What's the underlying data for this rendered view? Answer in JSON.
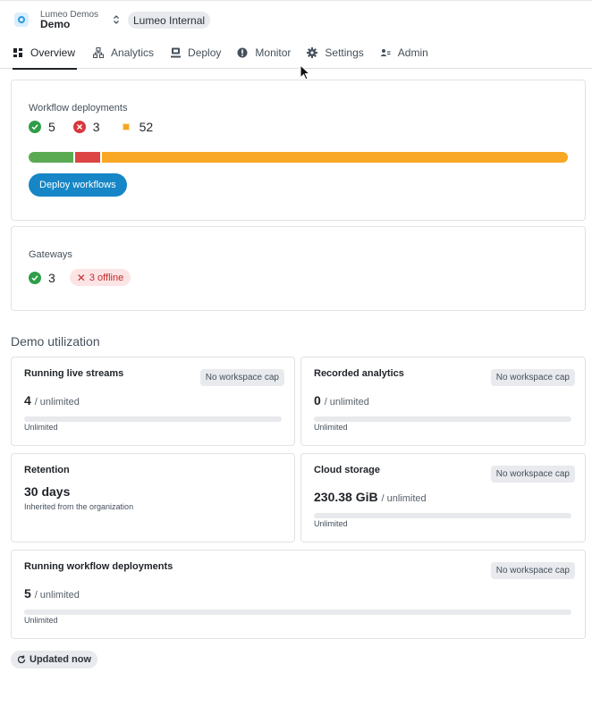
{
  "header": {
    "org_name": "Lumeo Demos",
    "workspace_name": "Demo",
    "workspace_badge": "Lumeo Internal"
  },
  "tabs": [
    {
      "label": "Overview",
      "icon": "dashboard-icon",
      "active": true
    },
    {
      "label": "Analytics",
      "icon": "analytics-icon",
      "active": false
    },
    {
      "label": "Deploy",
      "icon": "deploy-icon",
      "active": false
    },
    {
      "label": "Monitor",
      "icon": "monitor-alert-icon",
      "active": false
    },
    {
      "label": "Settings",
      "icon": "gear-icon",
      "active": false
    },
    {
      "label": "Admin",
      "icon": "admin-icon",
      "active": false
    }
  ],
  "deployments": {
    "title": "Workflow deployments",
    "running": "5",
    "errored": "3",
    "pending": "52",
    "bar": {
      "running": 5,
      "errored": 3,
      "pending": 52
    },
    "button_label": "Deploy workflows"
  },
  "gateways": {
    "title": "Gateways",
    "online": "3",
    "offline_label": "3 offline"
  },
  "utilization": {
    "title": "Demo utilization",
    "cap_label": "No workspace cap",
    "cards": {
      "live_streams": {
        "title": "Running live streams",
        "value": "4",
        "unit": "/ unlimited",
        "note": "Unlimited",
        "fill": 0
      },
      "recorded": {
        "title": "Recorded analytics",
        "value": "0",
        "unit": "/ unlimited",
        "note": "Unlimited",
        "fill": 0
      },
      "retention": {
        "title": "Retention",
        "value": "30 days",
        "note": "Inherited from the organization"
      },
      "storage": {
        "title": "Cloud storage",
        "value": "230.38 GiB",
        "unit": "/ unlimited",
        "note": "Unlimited",
        "fill": 0
      },
      "workflows": {
        "title": "Running workflow deployments",
        "value": "5",
        "unit": "/ unlimited",
        "note": "Unlimited",
        "fill": 0
      }
    }
  },
  "footer": {
    "updated_label": "Updated now"
  },
  "colors": {
    "success": "#2e9e48",
    "error": "#d9363e",
    "pending": "#f5a623",
    "accent": "#1686c6"
  }
}
